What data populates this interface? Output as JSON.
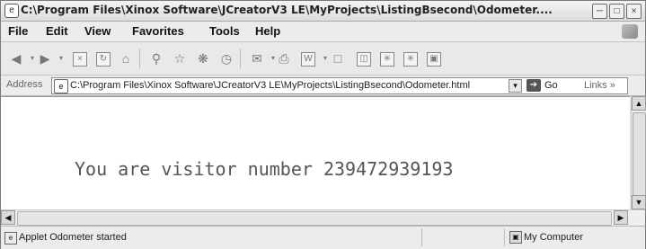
{
  "window": {
    "title": "C:\\Program Files\\Xinox Software\\JCreatorV3 LE\\MyProjects\\ListingBsecond\\Odometer....",
    "minimize_glyph": "─",
    "maximize_glyph": "□",
    "close_glyph": "×"
  },
  "menu": {
    "items": [
      "File",
      "Edit",
      "View",
      "Favorites",
      "Tools",
      "Help"
    ]
  },
  "toolbar": {
    "icons": [
      "back-icon",
      "forward-icon",
      "stop-icon",
      "refresh-icon",
      "home-icon",
      "search-icon",
      "favorites-icon",
      "media-icon",
      "history-icon",
      "mail-icon",
      "print-icon",
      "edit-icon",
      "discuss-icon",
      "messenger-icon",
      "research-icon",
      "applet-icon",
      "toolbar-extra-icon"
    ]
  },
  "address": {
    "label": "Address",
    "url": "C:\\Program Files\\Xinox Software\\JCreatorV3 LE\\MyProjects\\ListingBsecond\\Odometer.html",
    "go_label": "Go",
    "links_label": "Links"
  },
  "content": {
    "applet_text": "You are visitor number 239472939193"
  },
  "status": {
    "text": "Applet Odometer started",
    "zone": "My Computer"
  }
}
